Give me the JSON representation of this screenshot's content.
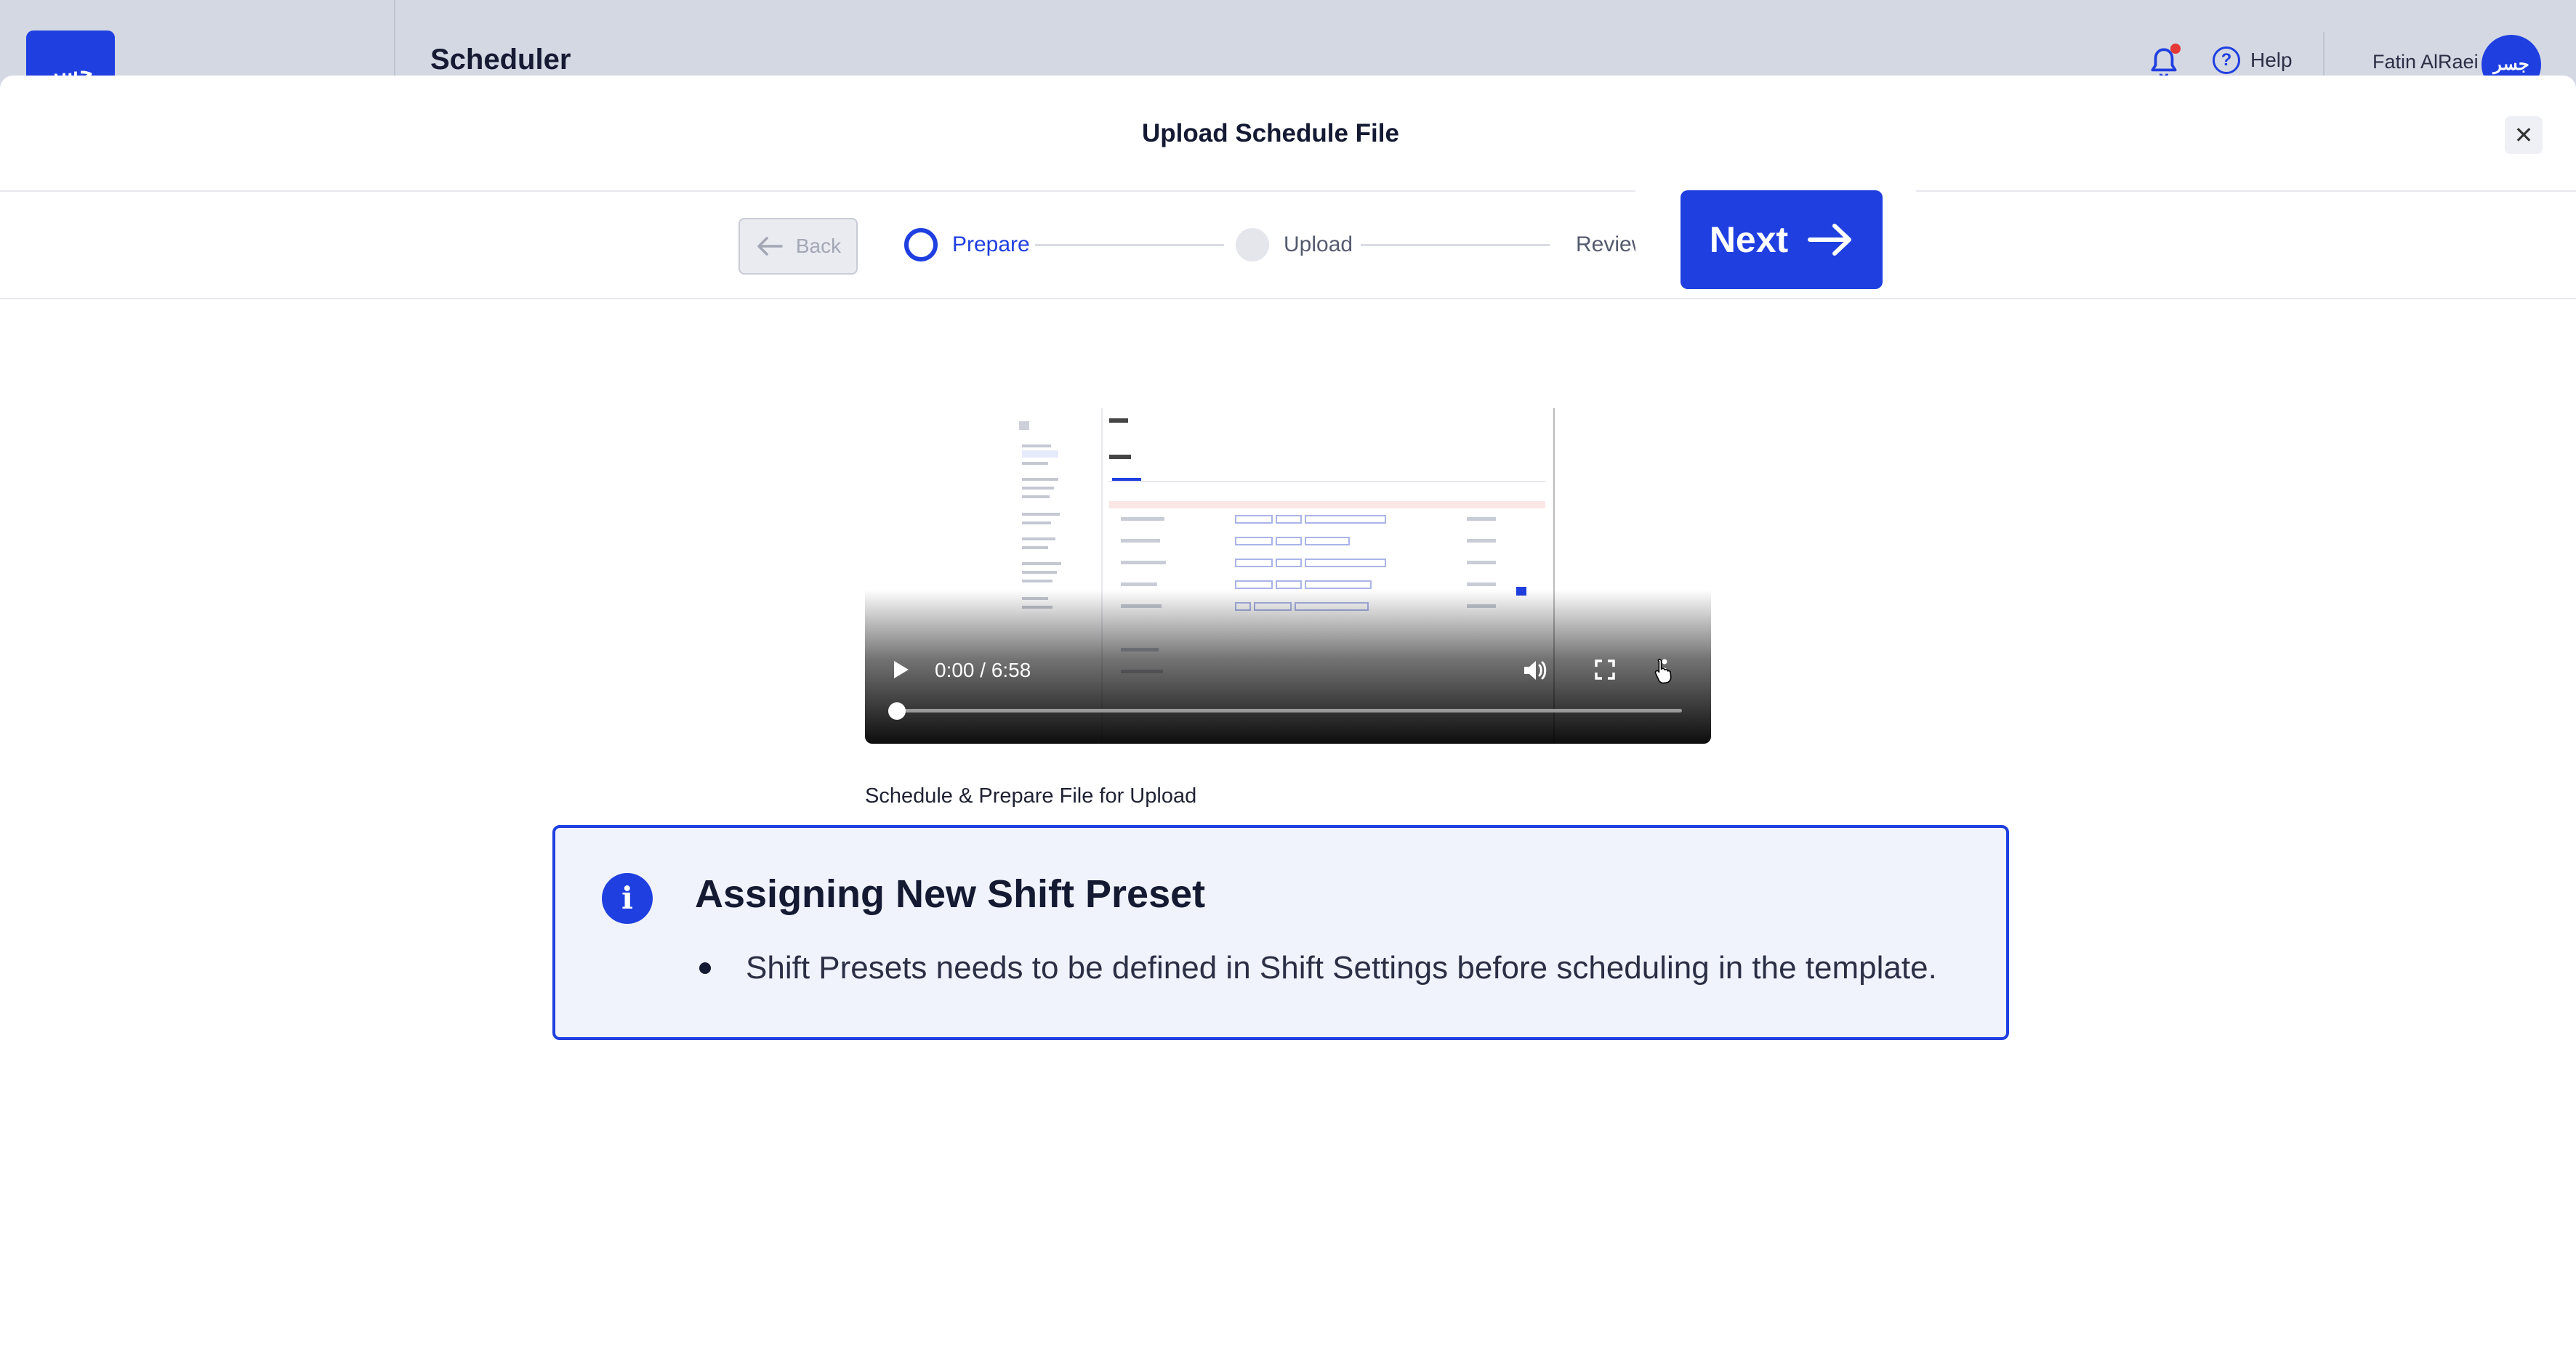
{
  "background_app": {
    "logo_text": "ﺟﺴﺮ",
    "title": "Scheduler",
    "help_label": "Help",
    "user_name": "Fatin AlRaei",
    "avatar_text": "ﺟﺴﺮ"
  },
  "modal": {
    "title": "Upload Schedule File",
    "close_symbol": "✕"
  },
  "stepper": {
    "back_label": "Back",
    "steps": [
      {
        "label": "Prepare",
        "state": "active"
      },
      {
        "label": "Upload",
        "state": "inactive"
      },
      {
        "label": "Review",
        "state": "inactive"
      }
    ],
    "next_label": "Next"
  },
  "video": {
    "time_display": "0:00 / 6:58",
    "progress": 0
  },
  "section_label": "Schedule & Prepare File for Upload",
  "info_box": {
    "icon": "info-icon",
    "heading": "Assigning New Shift Preset",
    "bullets": [
      "Shift Presets needs to be defined in Shift Settings before scheduling in the template."
    ]
  },
  "colors": {
    "accent": "#1f3fe0",
    "info_background": "#f0f3fb",
    "notification_dot": "#e53935"
  }
}
